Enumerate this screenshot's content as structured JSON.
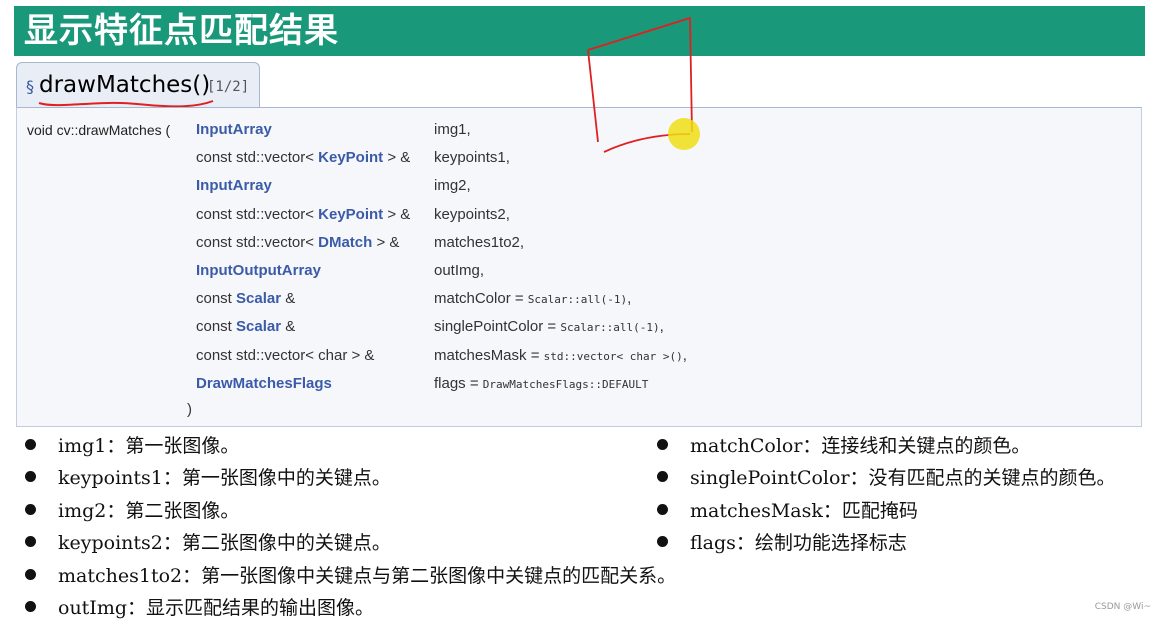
{
  "title": "显示特征点匹配结果",
  "tab": {
    "section_symbol": "§",
    "function_name": "drawMatches()",
    "page_indicator": "[1/2]"
  },
  "prototype": {
    "prefix": "void cv::drawMatches (",
    "params": [
      {
        "type_pre": "",
        "type_kw": "InputArray",
        "type_post": "",
        "name": "img1,",
        "default": ""
      },
      {
        "type_pre": "const std::vector< ",
        "type_kw": "KeyPoint",
        "type_post": " > &",
        "name": "keypoints1,",
        "default": ""
      },
      {
        "type_pre": "",
        "type_kw": "InputArray",
        "type_post": "",
        "name": "img2,",
        "default": ""
      },
      {
        "type_pre": "const std::vector< ",
        "type_kw": "KeyPoint",
        "type_post": " > &",
        "name": "keypoints2,",
        "default": ""
      },
      {
        "type_pre": "const std::vector< ",
        "type_kw": "DMatch",
        "type_post": " > &",
        "name": "matches1to2,",
        "default": ""
      },
      {
        "type_pre": "",
        "type_kw": "InputOutputArray",
        "type_post": "",
        "name": "outImg,",
        "default": ""
      },
      {
        "type_pre": "const ",
        "type_kw": "Scalar",
        "type_post": " &",
        "name": "matchColor = ",
        "default": "Scalar::all(-1)",
        "tail": ","
      },
      {
        "type_pre": "const ",
        "type_kw": "Scalar",
        "type_post": " &",
        "name": "singlePointColor = ",
        "default": "Scalar::all(-1)",
        "tail": ","
      },
      {
        "type_pre": "const std::vector< char > &",
        "type_kw": "",
        "type_post": "",
        "name": "matchesMask = ",
        "default": "std::vector< char >()",
        "tail": ","
      },
      {
        "type_pre": "",
        "type_kw": "DrawMatchesFlags",
        "type_post": "",
        "name": "flags = ",
        "default": "DrawMatchesFlags::DEFAULT",
        "tail": ""
      }
    ],
    "close": ")"
  },
  "bullets_left": [
    "img1：第一张图像。",
    "keypoints1：第一张图像中的关键点。",
    "img2：第二张图像。",
    "keypoints2：第二张图像中的关键点。",
    "matches1to2：第一张图像中关键点与第二张图像中关键点的匹配关系。",
    "outImg：显示匹配结果的输出图像。"
  ],
  "bullets_right": [
    "matchColor：连接线和关键点的颜色。",
    "singlePointColor：没有匹配点的关键点的颜色。",
    "matchesMask：匹配掩码",
    "flags：绘制功能选择标志"
  ],
  "watermark": "CSDN @Wi~",
  "colors": {
    "title_bar": "#19987a",
    "keyword": "#3b5ba8",
    "annotation": "#e02020",
    "cursor": "#eede14"
  }
}
